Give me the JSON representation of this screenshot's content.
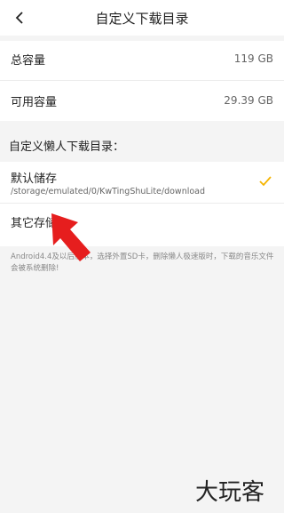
{
  "header": {
    "title": "自定义下载目录",
    "back_icon": "chevron-left-icon"
  },
  "storage": {
    "total_label": "总容量",
    "total_value": "119 GB",
    "available_label": "可用容量",
    "available_value": "29.39 GB"
  },
  "section": {
    "title": "自定义懒人下载目录："
  },
  "options": [
    {
      "name": "默认储存",
      "path": "/storage/emulated/0/KwTingShuLite/download",
      "selected": true
    },
    {
      "name": "其它存储",
      "path": "",
      "selected": false
    }
  ],
  "note": "Android4.4及以后版本，选择外置SD卡，删除懒人极速版时，下载的音乐文件会被系统删除!",
  "colors": {
    "accent": "#f5b400",
    "arrow": "#e61e1e",
    "background": "#f4f4f4"
  },
  "watermark": {
    "text": "大玩客"
  }
}
